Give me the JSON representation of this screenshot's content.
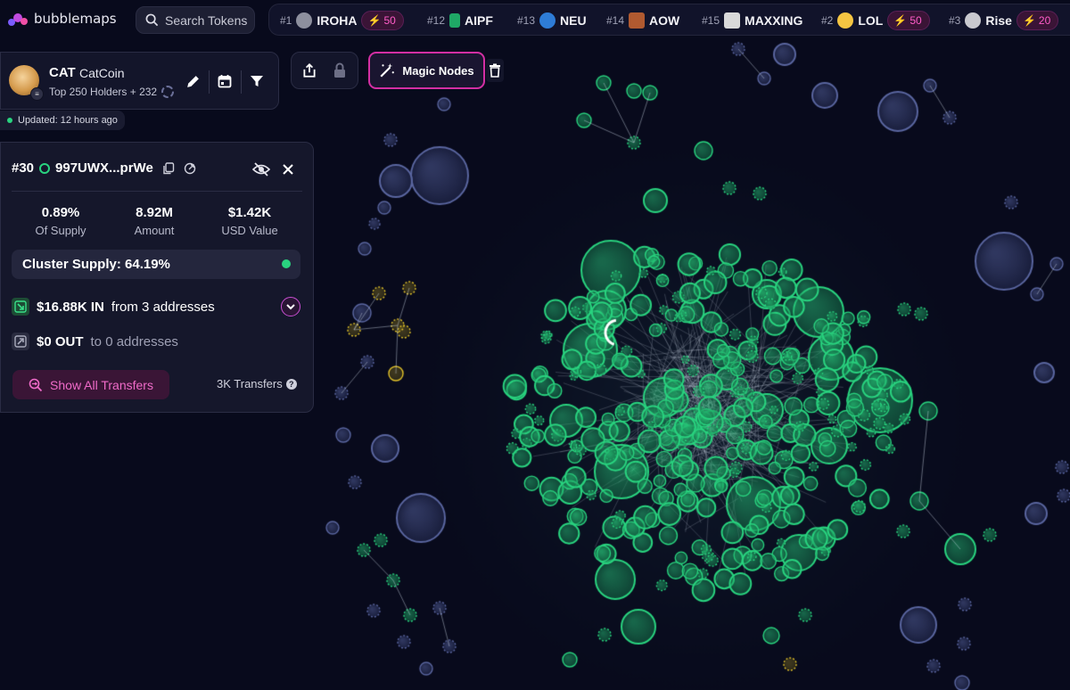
{
  "app": {
    "logo_text": "bubblemaps"
  },
  "search": {
    "placeholder": "Search Tokens"
  },
  "trending": [
    {
      "rank": "#1",
      "name": "IROHA",
      "boost": "50",
      "avatar_color": "#8d8f9e"
    },
    {
      "rank": "#12",
      "name": "AIPF",
      "boost": "",
      "avatar_color": "#1fa866"
    },
    {
      "rank": "#13",
      "name": "NEU",
      "boost": "",
      "avatar_color": "#2e7cd6"
    },
    {
      "rank": "#14",
      "name": "AOW",
      "boost": "",
      "avatar_color": "#b05a30"
    },
    {
      "rank": "#15",
      "name": "MAXXING",
      "boost": "",
      "avatar_color": "#d9d9d9"
    },
    {
      "rank": "#2",
      "name": "LOL",
      "boost": "50",
      "avatar_color": "#f5c542"
    },
    {
      "rank": "#3",
      "name": "Rise",
      "boost": "20",
      "avatar_color": "#c9c9cf"
    }
  ],
  "token": {
    "symbol": "CAT",
    "name": "CatCoin",
    "subtitle": "Top 250 Holders + 232",
    "updated": "Updated: 12 hours ago"
  },
  "toolbar": {
    "magic_nodes_label": "Magic Nodes"
  },
  "holder": {
    "rank": "#30",
    "address": "997UWX...prWe",
    "stats": [
      {
        "value": "0.89%",
        "label": "Of Supply"
      },
      {
        "value": "8.92M",
        "label": "Amount"
      },
      {
        "value": "$1.42K",
        "label": "USD Value"
      }
    ],
    "cluster_supply": "Cluster Supply: 64.19%",
    "inflow": {
      "amount": "$16.88K IN",
      "desc": "from 3 addresses"
    },
    "outflow": {
      "amount": "$0 OUT",
      "desc": "to 0 addresses"
    },
    "show_all_label": "Show All Transfers",
    "transfers_count": "3K Transfers"
  },
  "colors": {
    "background": "#080a1c",
    "bubble_green": "#29d37f",
    "bubble_blue": "#3b4470",
    "bubble_yellow": "#e0c02a",
    "accent_pink": "#d32fa3"
  }
}
